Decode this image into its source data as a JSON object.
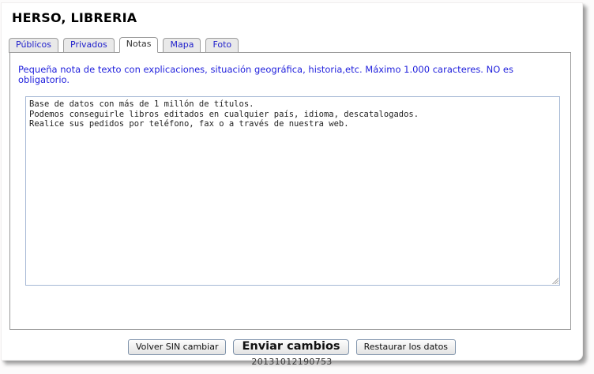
{
  "page": {
    "title": "HERSO, LIBRERIA"
  },
  "tabs": [
    {
      "label": "Públicos",
      "active": false
    },
    {
      "label": "Privados",
      "active": false
    },
    {
      "label": "Notas",
      "active": true
    },
    {
      "label": "Mapa",
      "active": false
    },
    {
      "label": "Foto",
      "active": false
    }
  ],
  "notes": {
    "instructions": "Pequeña nota de texto con explicaciones, situación geográfica, historia,etc. Máximo 1.000 caracteres. NO es obligatorio.",
    "value": "Base de datos con más de 1 millón de títulos.\nPodemos conseguirle libros editados en cualquier país, idioma, descatalogados.\nRealice sus pedidos por teléfono, fax o a través de nuestra web."
  },
  "footer": {
    "back_label": "Volver SIN cambiar",
    "submit_label": "Enviar cambios",
    "restore_label": "Restaurar los datos",
    "timestamp": "20131012190753"
  },
  "colors": {
    "tab_link_blue": "#2222cc",
    "instructions_blue": "#2222dd",
    "panel_border": "#999999",
    "textarea_border": "#a5b8d5",
    "button_border": "#7f93ab"
  }
}
